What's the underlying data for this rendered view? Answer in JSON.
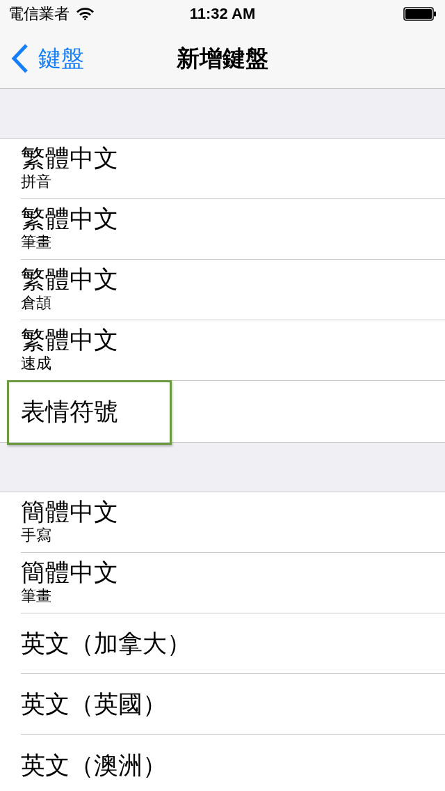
{
  "status_bar": {
    "carrier": "電信業者",
    "time": "11:32 AM"
  },
  "nav_bar": {
    "back_label": "鍵盤",
    "title": "新增鍵盤"
  },
  "sections": [
    {
      "rows": [
        {
          "title": "繁體中文",
          "subtitle": "拼音",
          "highlighted": false
        },
        {
          "title": "繁體中文",
          "subtitle": "筆畫",
          "highlighted": false
        },
        {
          "title": "繁體中文",
          "subtitle": "倉頡",
          "highlighted": false
        },
        {
          "title": "繁體中文",
          "subtitle": "速成",
          "highlighted": false
        },
        {
          "title": "表情符號",
          "highlighted": true
        }
      ]
    },
    {
      "rows": [
        {
          "title": "簡體中文",
          "subtitle": "手寫",
          "highlighted": false
        },
        {
          "title": "簡體中文",
          "subtitle": "筆畫",
          "highlighted": false
        },
        {
          "title": "英文（加拿大）",
          "highlighted": false
        },
        {
          "title": "英文（英國）",
          "highlighted": false
        },
        {
          "title": "英文（澳洲）",
          "highlighted": false
        }
      ]
    }
  ]
}
